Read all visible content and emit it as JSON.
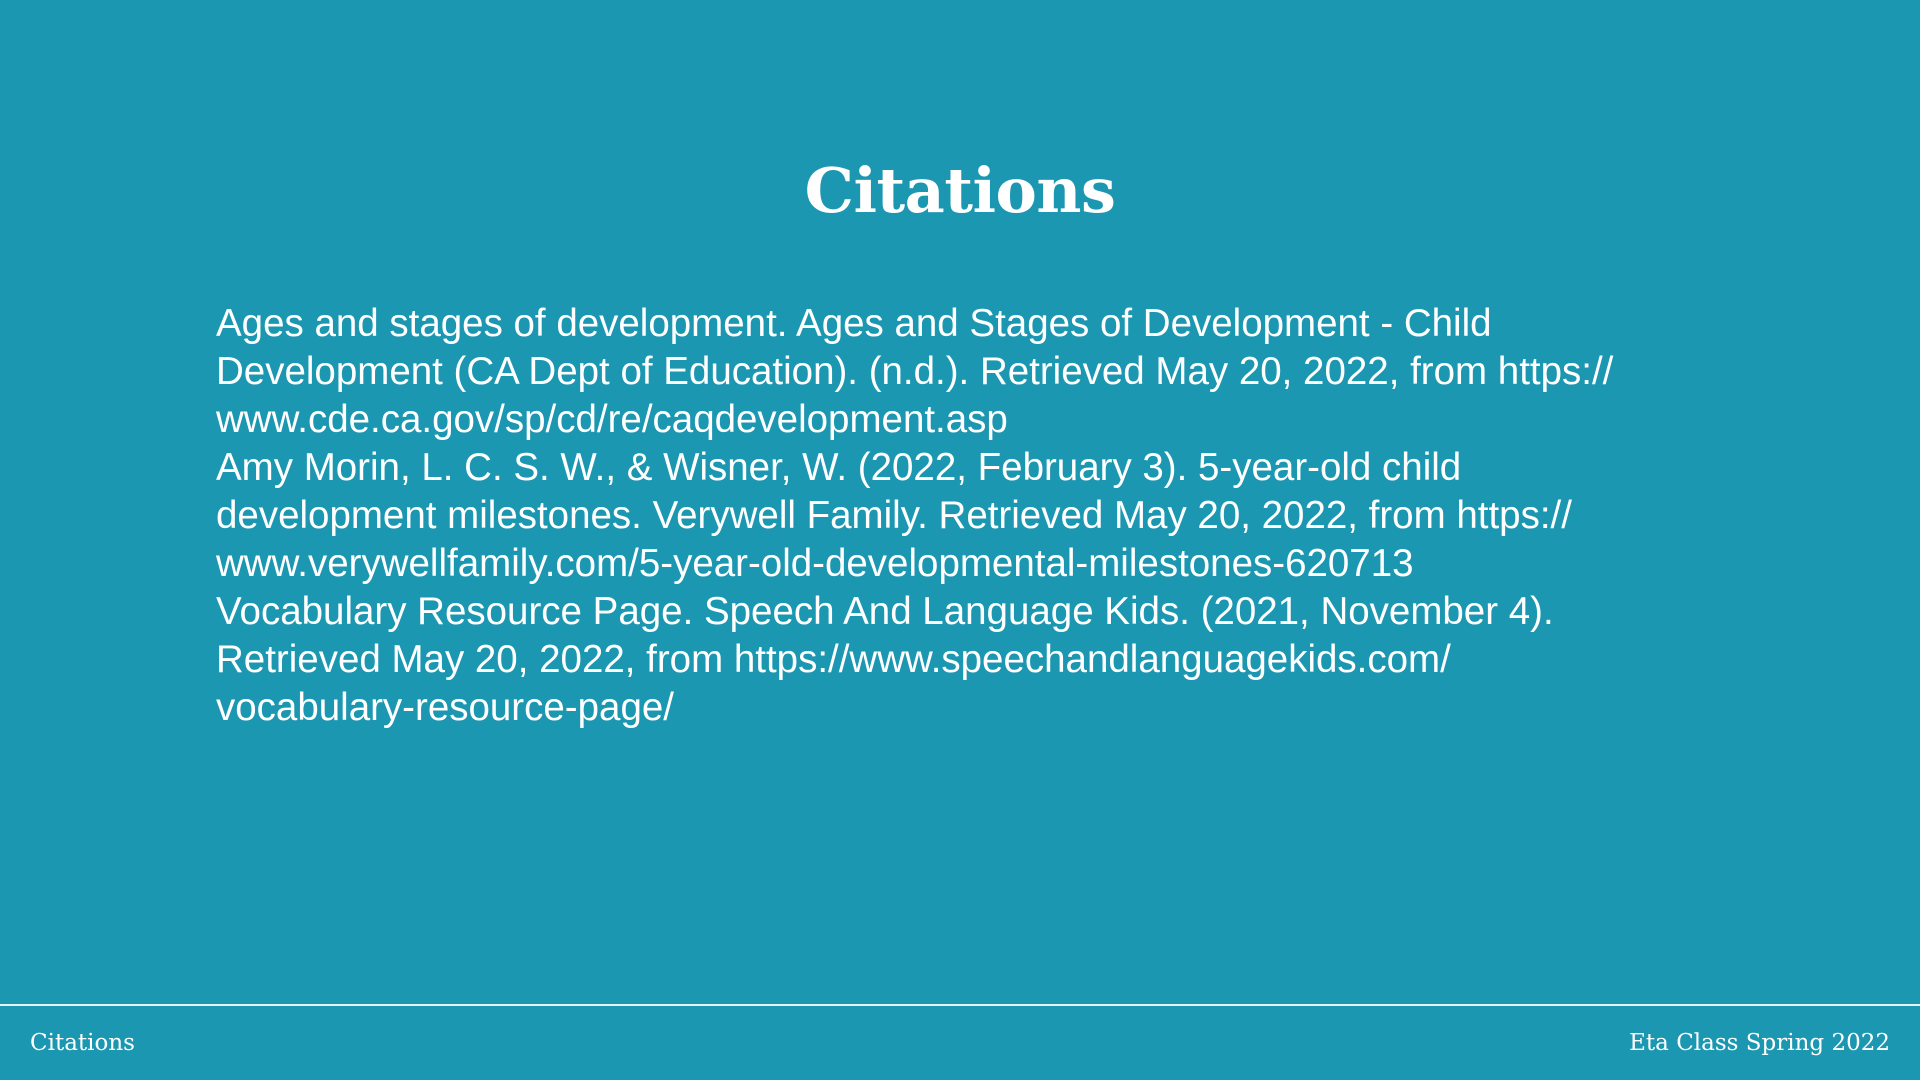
{
  "slide": {
    "title": "Citations",
    "background_color": "#1c97b1",
    "text_color": "#ffffff",
    "citations": [
      {
        "lines": [
          "Ages and stages of development. Ages and Stages of Development - Child",
          "Development (CA Dept of Education). (n.d.). Retrieved May 20, 2022, from https://",
          "www.cde.ca.gov/sp/cd/re/caqdevelopment.asp"
        ]
      },
      {
        "lines": [
          "Amy Morin, L. C. S. W., & Wisner, W. (2022, February 3). 5-year-old child",
          "development milestones. Verywell Family. Retrieved May 20, 2022, from https://",
          "www.verywellfamily.com/5-year-old-developmental-milestones-620713"
        ]
      },
      {
        "lines": [
          "Vocabulary Resource Page. Speech And Language Kids. (2021, November 4).",
          "Retrieved May 20, 2022, from https://www.speechandlanguagekids.com/",
          "vocabulary-resource-page/"
        ]
      }
    ]
  },
  "footer": {
    "left": "Citations",
    "right": "Eta Class Spring 2022"
  }
}
